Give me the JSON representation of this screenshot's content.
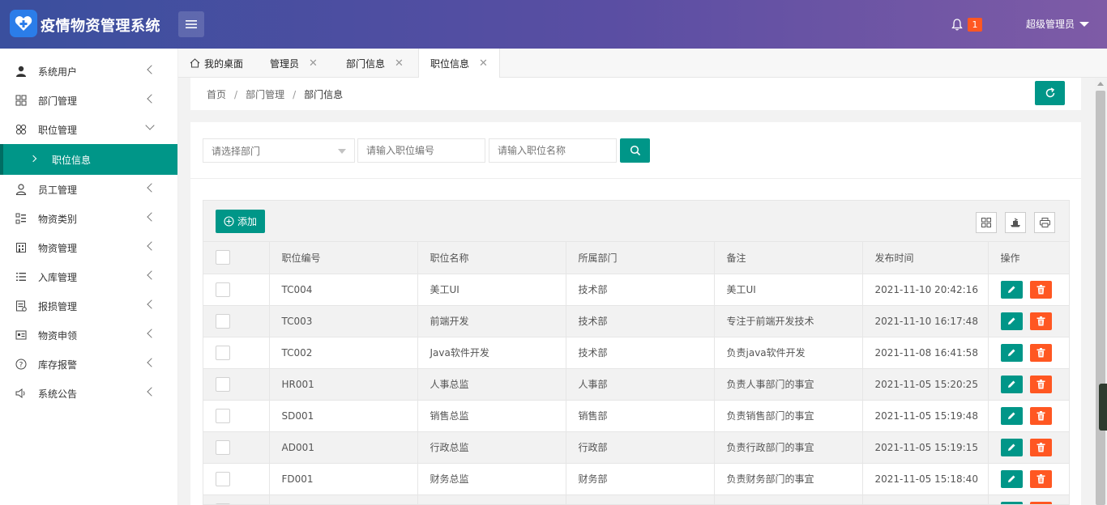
{
  "header": {
    "app_title": "疫情物资管理系统",
    "notification_count": "1",
    "user_name": "超级管理员"
  },
  "sidebar": {
    "items": [
      {
        "label": "系统用户",
        "icon": "user-icon"
      },
      {
        "label": "部门管理",
        "icon": "grid-icon"
      },
      {
        "label": "职位管理",
        "icon": "clover-icon",
        "expanded": true
      },
      {
        "label": "员工管理",
        "icon": "person-outline-icon"
      },
      {
        "label": "物资类别",
        "icon": "list-icon"
      },
      {
        "label": "物资管理",
        "icon": "building-icon"
      },
      {
        "label": "入库管理",
        "icon": "list-lines-icon"
      },
      {
        "label": "报损管理",
        "icon": "document-icon"
      },
      {
        "label": "物资申领",
        "icon": "card-icon"
      },
      {
        "label": "库存报警",
        "icon": "question-icon"
      },
      {
        "label": "系统公告",
        "icon": "speaker-icon"
      }
    ],
    "active_sub": "职位信息"
  },
  "tabs": [
    {
      "label": "我的桌面",
      "icon": "home-icon"
    },
    {
      "label": "管理员"
    },
    {
      "label": "部门信息"
    },
    {
      "label": "职位信息",
      "active": true
    }
  ],
  "breadcrumb": [
    "首页",
    "部门管理",
    "部门信息"
  ],
  "search": {
    "department_placeholder": "请选择部门",
    "code_placeholder": "请输入职位编号",
    "name_placeholder": "请输入职位名称"
  },
  "toolbar": {
    "add_label": "添加"
  },
  "table": {
    "headers": [
      "职位编号",
      "职位名称",
      "所属部门",
      "备注",
      "发布时间",
      "操作"
    ],
    "rows": [
      [
        "TC004",
        "美工UI",
        "技术部",
        "美工UI",
        "2021-11-10 20:42:16"
      ],
      [
        "TC003",
        "前端开发",
        "技术部",
        "专注于前端开发技术",
        "2021-11-10 16:17:48"
      ],
      [
        "TC002",
        "Java软件开发",
        "技术部",
        "负责java软件开发",
        "2021-11-08 16:41:58"
      ],
      [
        "HR001",
        "人事总监",
        "人事部",
        "负责人事部门的事宜",
        "2021-11-05 15:20:25"
      ],
      [
        "SD001",
        "销售总监",
        "销售部",
        "负责销售部门的事宜",
        "2021-11-05 15:19:48"
      ],
      [
        "AD001",
        "行政总监",
        "行政部",
        "负责行政部门的事宜",
        "2021-11-05 15:19:15"
      ],
      [
        "FD001",
        "财务总监",
        "财务部",
        "负责财务部门的事宜",
        "2021-11-05 15:18:40"
      ],
      [
        "",
        "",
        "",
        "",
        ""
      ]
    ]
  },
  "colors": {
    "primary": "#009688",
    "danger": "#ff5722"
  }
}
